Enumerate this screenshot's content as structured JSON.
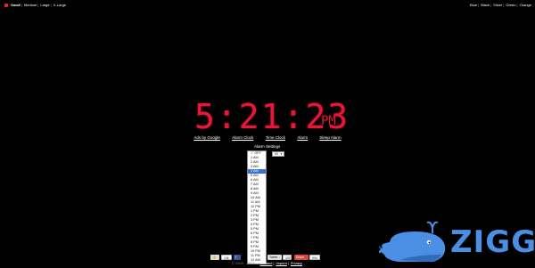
{
  "sizes": {
    "items": [
      {
        "label": "Small",
        "active": true
      },
      {
        "label": "Medium",
        "active": false
      },
      {
        "label": "Large",
        "active": false
      },
      {
        "label": "X-Large",
        "active": false
      }
    ]
  },
  "colors": {
    "items": [
      {
        "label": "Blue",
        "active": false
      },
      {
        "label": "Black",
        "active": false
      },
      {
        "label": "Silver",
        "active": false
      },
      {
        "label": "Green",
        "active": false
      },
      {
        "label": "Orange",
        "active": false
      }
    ]
  },
  "clock": {
    "time": "5:21:23",
    "period": "PM",
    "digit_color": "#e8173a"
  },
  "nav": {
    "links": [
      "Ads by Google",
      "Alarm Clock",
      "Time Clock",
      "Alarm",
      "Sleep Alarm"
    ]
  },
  "alarm": {
    "title": "Alarm Settings",
    "hour_options": [
      "OFF",
      "1 AM",
      "2 AM",
      "3 AM",
      "4 AM",
      "5 AM",
      "6 AM",
      "7 AM",
      "8 AM",
      "9 AM",
      "10 AM",
      "11 AM",
      "12 PM",
      "1 PM",
      "2 PM",
      "3 PM",
      "4 PM",
      "5 PM",
      "6 PM",
      "7 PM",
      "8 PM",
      "9 PM",
      "10 PM",
      "11 PM",
      "12 AM"
    ],
    "checked_option": "OFF",
    "highlighted_option": "4 AM",
    "minute_select_value": "00"
  },
  "social": {
    "like_count": "13k",
    "tweet_label": "Tweet",
    "tweet_count": "432",
    "share_label": "Share",
    "share_count": "994"
  },
  "footer": {
    "copyright": "© 2009 - 2012",
    "links": [
      "Contact",
      "Imprint",
      "Privacy"
    ]
  },
  "brand": {
    "name": "ZIGG",
    "color": "#4a8fe3"
  }
}
